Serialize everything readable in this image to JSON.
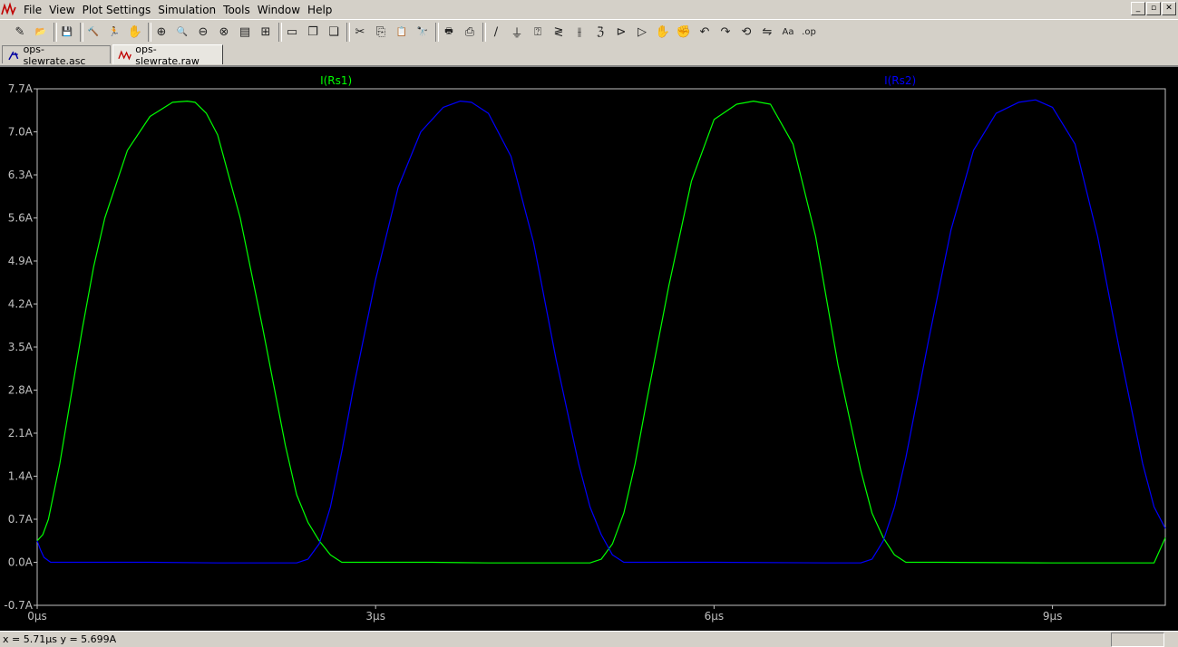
{
  "menubar": {
    "items": [
      "File",
      "View",
      "Plot Settings",
      "Simulation",
      "Tools",
      "Window",
      "Help"
    ],
    "window_buttons": [
      "_",
      "▫",
      "✕"
    ]
  },
  "toolbar": {
    "buttons": [
      {
        "name": "new-schematic-icon",
        "glyph": "✎"
      },
      {
        "name": "open-icon",
        "glyph": "📂"
      },
      {
        "name": "save-icon",
        "glyph": "💾"
      },
      {
        "name": "control-panel-icon",
        "glyph": "🔨"
      },
      {
        "name": "run-icon",
        "glyph": "🏃"
      },
      {
        "name": "halt-icon",
        "glyph": "✋"
      },
      {
        "name": "zoom-in-icon",
        "glyph": "⊕"
      },
      {
        "name": "zoom-area-icon",
        "glyph": "🔍"
      },
      {
        "name": "zoom-out-icon",
        "glyph": "⊖"
      },
      {
        "name": "zoom-cancel-icon",
        "glyph": "⊗"
      },
      {
        "name": "autorange-icon",
        "glyph": "▤"
      },
      {
        "name": "zoom-full-icon",
        "glyph": "⊞"
      },
      {
        "name": "tile-horizontal-icon",
        "glyph": "▭"
      },
      {
        "name": "cascade-icon",
        "glyph": "❐"
      },
      {
        "name": "tile-vertical-icon",
        "glyph": "❏"
      },
      {
        "name": "cut-icon",
        "glyph": "✂"
      },
      {
        "name": "copy-icon",
        "glyph": "⎘"
      },
      {
        "name": "paste-icon",
        "glyph": "📋"
      },
      {
        "name": "find-icon",
        "glyph": "🔭"
      },
      {
        "name": "print-preview-icon",
        "glyph": "🖶"
      },
      {
        "name": "print-icon",
        "glyph": "⎙"
      },
      {
        "name": "wire-icon",
        "glyph": "∕"
      },
      {
        "name": "ground-icon",
        "glyph": "⏚"
      },
      {
        "name": "label-net-icon",
        "glyph": "⍰"
      },
      {
        "name": "resistor-icon",
        "glyph": "≷"
      },
      {
        "name": "capacitor-icon",
        "glyph": "⫲"
      },
      {
        "name": "inductor-icon",
        "glyph": "ℨ"
      },
      {
        "name": "diode-icon",
        "glyph": "⊳"
      },
      {
        "name": "component-icon",
        "glyph": "▷"
      },
      {
        "name": "move-icon",
        "glyph": "✋"
      },
      {
        "name": "drag-icon",
        "glyph": "✊"
      },
      {
        "name": "undo-icon",
        "glyph": "↶"
      },
      {
        "name": "redo-icon",
        "glyph": "↷"
      },
      {
        "name": "rotate-icon",
        "glyph": "⟲"
      },
      {
        "name": "mirror-icon",
        "glyph": "⇋"
      },
      {
        "name": "text-icon",
        "glyph": "Aa"
      },
      {
        "name": "spice-directive-icon",
        "glyph": ".op"
      }
    ]
  },
  "tabs": [
    {
      "label": "ops-slewrate.asc",
      "icon": "schematic-icon",
      "active": false
    },
    {
      "label": "ops-slewrate.raw",
      "icon": "waveform-icon",
      "active": true
    }
  ],
  "colors": {
    "plot_background": "#000000",
    "grid": "#c0c0c0",
    "trace1": "#00ff00",
    "trace2": "#0000ff",
    "axis_text": "#c0c0c0"
  },
  "chart_data": {
    "type": "line",
    "x_unit": "µs",
    "y_unit": "A",
    "xlim": [
      0,
      10
    ],
    "ylim": [
      -0.7,
      7.7
    ],
    "x_ticks": [
      "0µs",
      "3µs",
      "6µs",
      "9µs"
    ],
    "x_tick_values": [
      0,
      3,
      6,
      9
    ],
    "y_ticks": [
      "7.7A",
      "7.0A",
      "6.3A",
      "5.6A",
      "4.9A",
      "4.2A",
      "3.5A",
      "2.8A",
      "2.1A",
      "1.4A",
      "0.7A",
      "0.0A",
      "-0.7A"
    ],
    "y_tick_values": [
      7.7,
      7.0,
      6.3,
      5.6,
      4.9,
      4.2,
      3.5,
      2.8,
      2.1,
      1.4,
      0.7,
      0.0,
      -0.7
    ],
    "grid": false,
    "series": [
      {
        "name": "I(Rs1)",
        "color": "#00ff00",
        "x": [
          0,
          0.05,
          0.1,
          0.2,
          0.3,
          0.4,
          0.5,
          0.6,
          0.8,
          1.0,
          1.2,
          1.33,
          1.4,
          1.5,
          1.6,
          1.8,
          2.0,
          2.2,
          2.3,
          2.4,
          2.5,
          2.6,
          2.7,
          2.9,
          3.5,
          4.0,
          4.5,
          4.9,
          5.0,
          5.1,
          5.2,
          5.3,
          5.4,
          5.6,
          5.8,
          6.0,
          6.2,
          6.35,
          6.5,
          6.7,
          6.9,
          7.1,
          7.3,
          7.4,
          7.5,
          7.6,
          7.7,
          7.8,
          8.0,
          9.0,
          9.5,
          9.9,
          10.0
        ],
        "y": [
          0.35,
          0.45,
          0.7,
          1.6,
          2.7,
          3.8,
          4.8,
          5.6,
          6.7,
          7.25,
          7.48,
          7.5,
          7.48,
          7.3,
          6.95,
          5.6,
          3.8,
          1.9,
          1.1,
          0.65,
          0.35,
          0.12,
          0.0,
          0.0,
          0.0,
          -0.01,
          -0.01,
          -0.01,
          0.05,
          0.3,
          0.8,
          1.6,
          2.6,
          4.5,
          6.2,
          7.2,
          7.45,
          7.5,
          7.45,
          6.8,
          5.3,
          3.2,
          1.5,
          0.8,
          0.4,
          0.12,
          0.0,
          0.0,
          0.0,
          -0.01,
          -0.01,
          -0.01,
          0.4
        ]
      },
      {
        "name": "I(Rs2)",
        "color": "#0000ff",
        "x": [
          0,
          0.03,
          0.06,
          0.12,
          0.2,
          1.0,
          1.6,
          2.0,
          2.3,
          2.4,
          2.5,
          2.6,
          2.7,
          2.8,
          3.0,
          3.2,
          3.4,
          3.6,
          3.75,
          3.85,
          4.0,
          4.2,
          4.4,
          4.6,
          4.8,
          4.9,
          5.0,
          5.1,
          5.2,
          5.4,
          6.0,
          7.0,
          7.3,
          7.4,
          7.5,
          7.6,
          7.7,
          7.9,
          8.1,
          8.3,
          8.5,
          8.7,
          8.85,
          9.0,
          9.2,
          9.4,
          9.6,
          9.8,
          9.9,
          10.0
        ],
        "y": [
          0.35,
          0.2,
          0.08,
          0.0,
          0.0,
          0.0,
          -0.01,
          -0.01,
          -0.01,
          0.05,
          0.3,
          0.9,
          1.8,
          2.8,
          4.6,
          6.1,
          7.0,
          7.4,
          7.5,
          7.48,
          7.3,
          6.6,
          5.2,
          3.3,
          1.6,
          0.9,
          0.45,
          0.12,
          0.0,
          0.0,
          0.0,
          -0.01,
          -0.01,
          0.05,
          0.35,
          0.9,
          1.7,
          3.6,
          5.4,
          6.7,
          7.3,
          7.48,
          7.52,
          7.4,
          6.8,
          5.3,
          3.4,
          1.6,
          0.9,
          0.55
        ]
      }
    ]
  },
  "status": {
    "text": "x = 5.71µs    y = 5.699A"
  }
}
